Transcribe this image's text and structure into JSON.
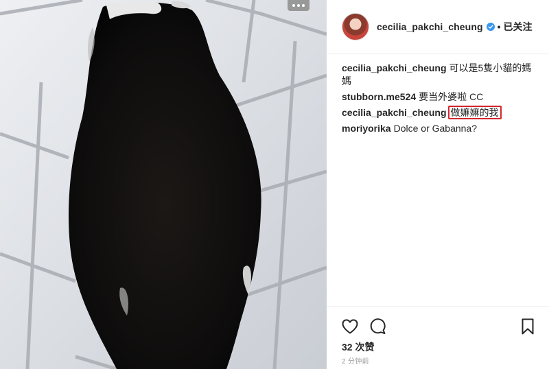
{
  "post": {
    "image_alt": "black and white cat on tiled floor",
    "author": {
      "username": "cecilia_pakchi_cheung",
      "verified": true,
      "separator": "•",
      "follow_status": "已关注"
    },
    "comments": [
      {
        "user": "cecilia_pakchi_cheung",
        "text": "可以是5隻小貓的媽媽",
        "highlight": false
      },
      {
        "user": "stubborn.me524",
        "text": "要当外婆啦 CC",
        "highlight": false
      },
      {
        "user": "cecilia_pakchi_cheung",
        "text": "做嫲嫲的我",
        "highlight": true
      },
      {
        "user": "moriyorika",
        "text": "Dolce or Gabanna?",
        "highlight": false
      }
    ],
    "likes": "32 次赞",
    "timestamp": "2 分钟前"
  },
  "icons": {
    "more": "more-options-icon",
    "heart": "heart-icon",
    "comment": "comment-icon",
    "bookmark": "bookmark-icon",
    "verified": "verified-badge-icon"
  },
  "colors": {
    "verified": "#3897f0",
    "highlight_box": "#d4262c",
    "text": "#262626",
    "muted": "#999999"
  }
}
